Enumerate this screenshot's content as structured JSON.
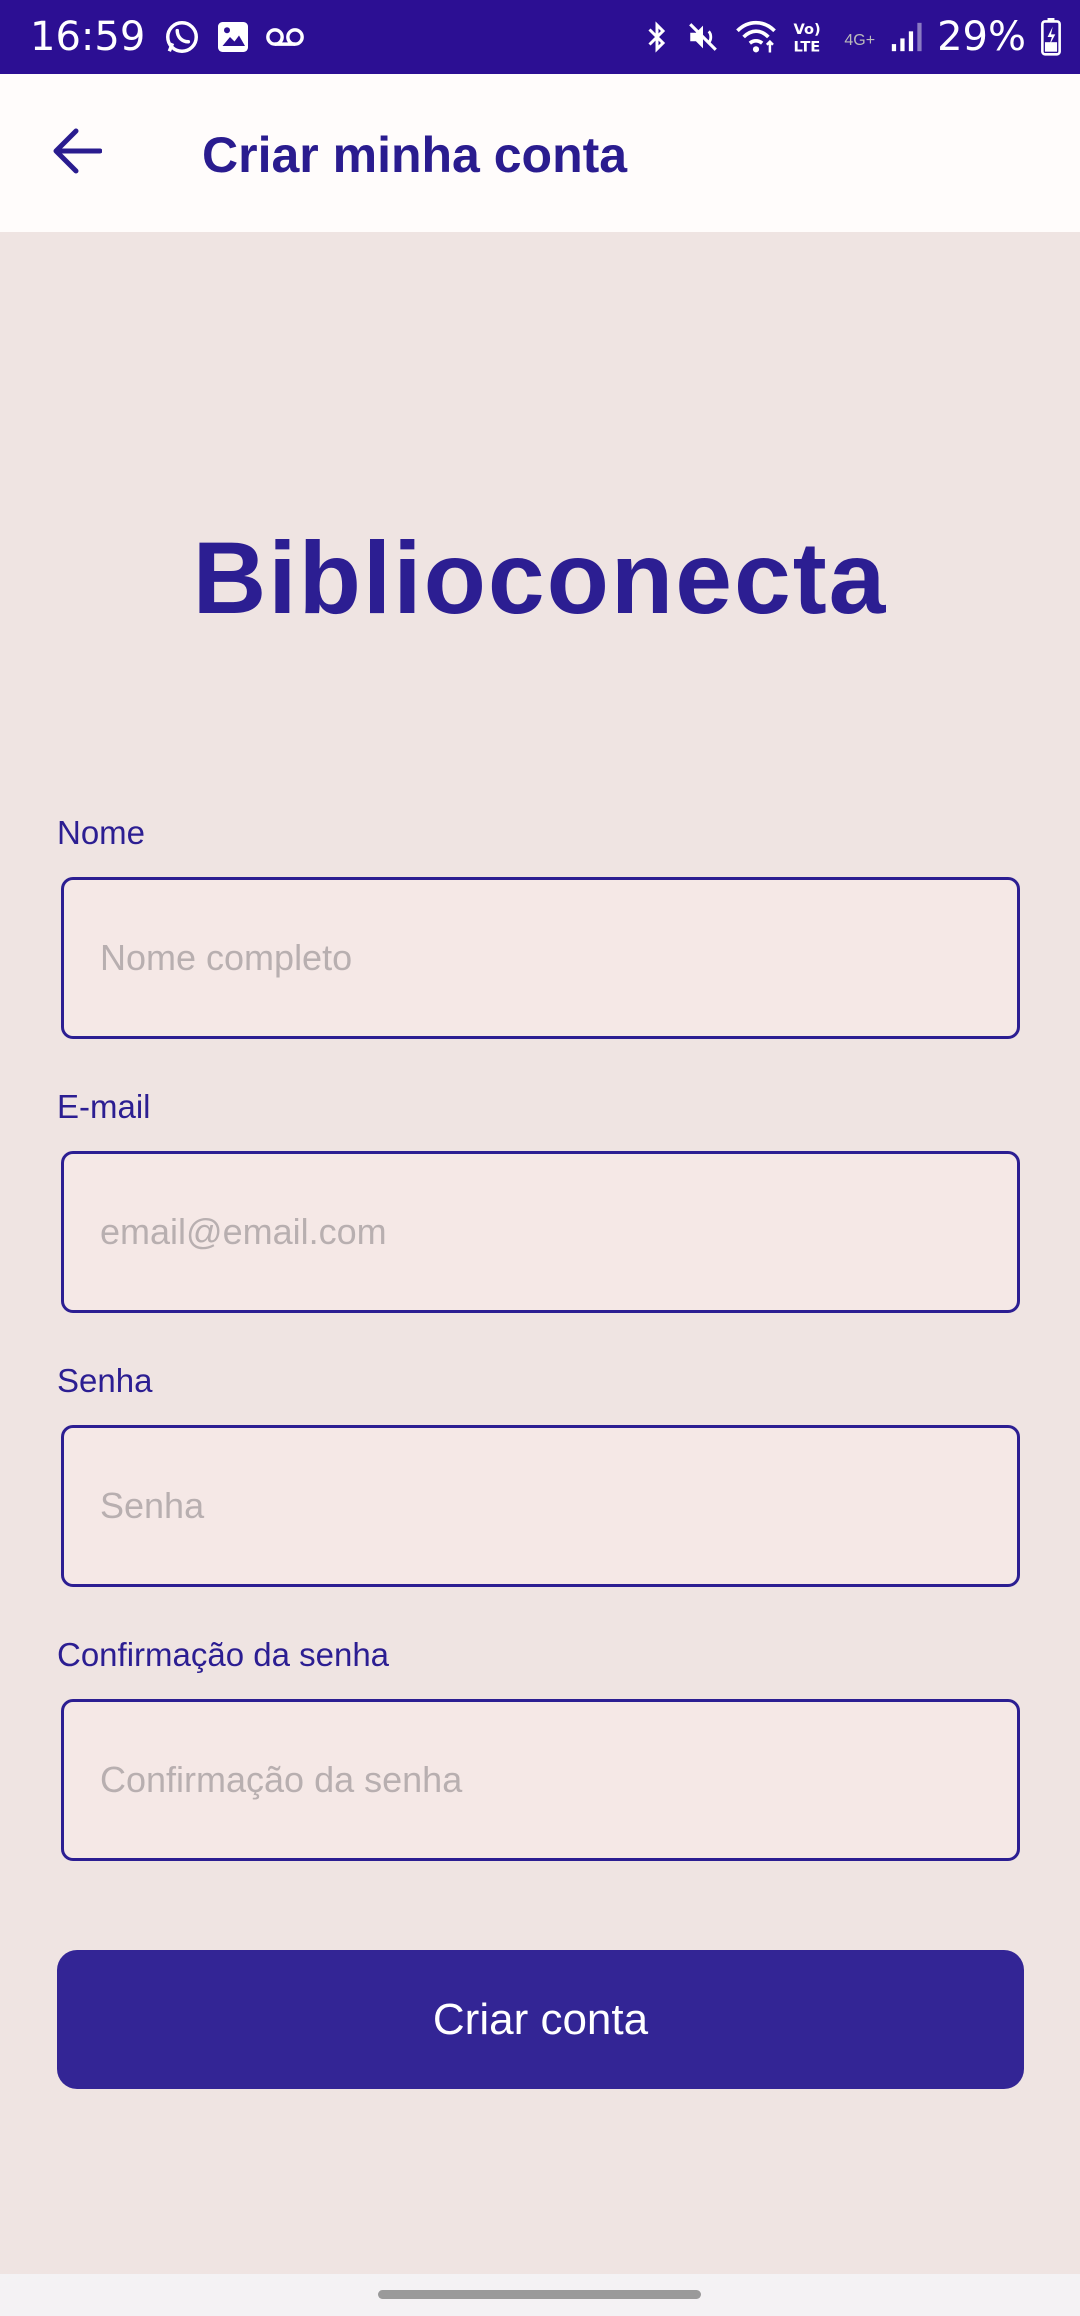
{
  "status_bar": {
    "time": "16:59",
    "battery_percent": "29%",
    "network_label": "4G+",
    "volte_label": "Vo) LTE",
    "icons_left": [
      "whatsapp-icon",
      "image-icon",
      "voicemail-icon"
    ],
    "icons_right": [
      "bluetooth-icon",
      "mute-icon",
      "wifi-icon",
      "volte-icon",
      "signal-icon",
      "battery-icon"
    ]
  },
  "app_bar": {
    "title": "Criar minha conta",
    "back_icon": "arrow-left-icon"
  },
  "brand": {
    "name": "Biblioconecta"
  },
  "form": {
    "fields": [
      {
        "label": "Nome",
        "placeholder": "Nome completo",
        "value": ""
      },
      {
        "label": "E-mail",
        "placeholder": "email@email.com",
        "value": ""
      },
      {
        "label": "Senha",
        "placeholder": "Senha",
        "value": ""
      },
      {
        "label": "Confirmação da senha",
        "placeholder": "Confirmação da senha",
        "value": ""
      }
    ],
    "submit_label": "Criar conta"
  },
  "colors": {
    "status_bar": "#2C0F93",
    "primary": "#2C1E92",
    "button": "#332595",
    "background": "#EFE4E2",
    "input_fill": "#F5E8E6"
  }
}
